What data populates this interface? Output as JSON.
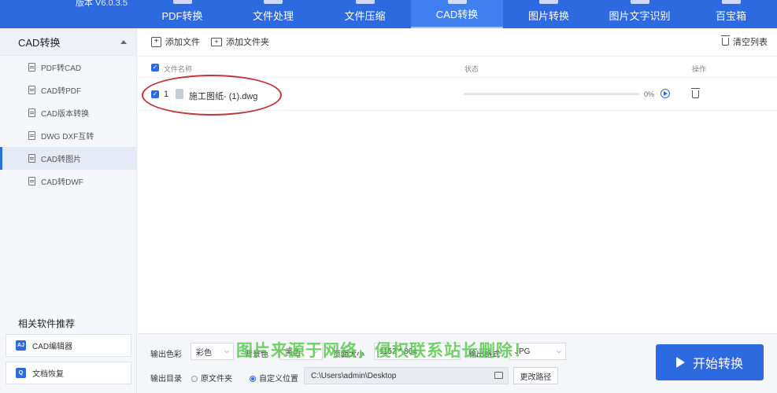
{
  "app": {
    "version": "版本 V6.0.3.5"
  },
  "nav": {
    "tabs": [
      {
        "label": "PDF转换"
      },
      {
        "label": "文件处理"
      },
      {
        "label": "文件压缩"
      },
      {
        "label": "CAD转换",
        "active": true
      },
      {
        "label": "图片转换"
      },
      {
        "label": "图片文字识别"
      },
      {
        "label": "百宝箱"
      }
    ]
  },
  "sidebar": {
    "header": "CAD转换",
    "items": [
      {
        "label": "PDF转CAD"
      },
      {
        "label": "CAD转PDF"
      },
      {
        "label": "CAD版本转换"
      },
      {
        "label": "DWG DXF互转"
      },
      {
        "label": "CAD转图片",
        "active": true
      },
      {
        "label": "CAD转DWF"
      }
    ],
    "recommend_title": "相关软件推荐",
    "recommend": [
      {
        "label": "CAD编辑器",
        "icon": "AJ"
      },
      {
        "label": "文档恢复",
        "icon": "Q"
      }
    ]
  },
  "toolbar": {
    "add_file": "添加文件",
    "add_folder": "添加文件夹",
    "clear_list": "清空列表"
  },
  "table": {
    "headers": {
      "name": "文件名称",
      "status": "状态",
      "action": "操作"
    },
    "rows": [
      {
        "index": "1",
        "name": "施工图纸- (1).dwg",
        "progress_text": "0%",
        "progress": 0
      }
    ]
  },
  "settings": {
    "color_label": "输出色彩",
    "color_value": "彩色",
    "bg_label": "背景色",
    "bg_value": "黑色",
    "page_label": "页面大小",
    "page_value": "1152 * 864",
    "format_label": "输出格式",
    "format_value": "JPG",
    "dir_label": "输出目录",
    "dir_option_original": "原文件夹",
    "dir_option_custom": "自定义位置",
    "dir_path": "C:\\Users\\admin\\Desktop",
    "change_path": "更改路径"
  },
  "start_button": "开始转换",
  "watermark": "图片来源于网络，侵权联系站长删除！",
  "colors": {
    "accent": "#2d6ae0",
    "annotation": "#c0383b",
    "watermark": "#5ac850"
  }
}
